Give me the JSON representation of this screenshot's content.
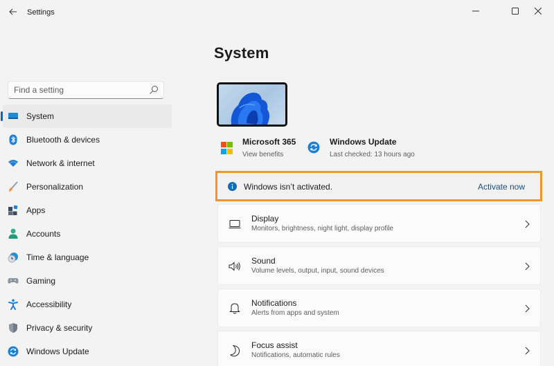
{
  "window": {
    "title": "Settings",
    "back_icon": "arrow-left-icon",
    "controls": [
      "minimize-icon",
      "maximize-icon",
      "close-icon"
    ]
  },
  "search": {
    "placeholder": "Find a setting",
    "value": "",
    "icon": "search-icon"
  },
  "sidebar": {
    "items": [
      {
        "label": "System",
        "icon": "system-monitor-icon",
        "active": true
      },
      {
        "label": "Bluetooth & devices",
        "icon": "bluetooth-icon",
        "active": false
      },
      {
        "label": "Network & internet",
        "icon": "wifi-icon",
        "active": false
      },
      {
        "label": "Personalization",
        "icon": "paintbrush-icon",
        "active": false
      },
      {
        "label": "Apps",
        "icon": "apps-icon",
        "active": false
      },
      {
        "label": "Accounts",
        "icon": "person-icon",
        "active": false
      },
      {
        "label": "Time & language",
        "icon": "clock-globe-icon",
        "active": false
      },
      {
        "label": "Gaming",
        "icon": "gamepad-icon",
        "active": false
      },
      {
        "label": "Accessibility",
        "icon": "accessibility-icon",
        "active": false
      },
      {
        "label": "Privacy & security",
        "icon": "shield-icon",
        "active": false
      },
      {
        "label": "Windows Update",
        "icon": "windows-update-icon",
        "active": false
      }
    ]
  },
  "main": {
    "title": "System",
    "device_image": "device-wallpaper",
    "quick_links": [
      {
        "title": "Microsoft 365",
        "subtitle": "View benefits",
        "icon": "microsoft-logo-icon"
      },
      {
        "title": "Windows Update",
        "subtitle": "Last checked: 13 hours ago",
        "icon": "windows-update-icon"
      }
    ],
    "banner": {
      "icon": "info-icon",
      "text": "Windows isn’t activated.",
      "action": "Activate now",
      "highlight_color": "#f0962b"
    },
    "cards": [
      {
        "title": "Display",
        "subtitle": "Monitors, brightness, night light, display profile",
        "icon": "display-icon"
      },
      {
        "title": "Sound",
        "subtitle": "Volume levels, output, input, sound devices",
        "icon": "speaker-icon"
      },
      {
        "title": "Notifications",
        "subtitle": "Alerts from apps and system",
        "icon": "bell-icon"
      },
      {
        "title": "Focus assist",
        "subtitle": "Notifications, automatic rules",
        "icon": "moon-icon"
      }
    ]
  },
  "colors": {
    "accent": "#0067c0",
    "background": "#f3f3f3",
    "card": "#fbfbfb",
    "ms_red": "#f25022",
    "ms_green": "#7fba00",
    "ms_blue": "#00a4ef",
    "ms_yellow": "#ffb900"
  }
}
